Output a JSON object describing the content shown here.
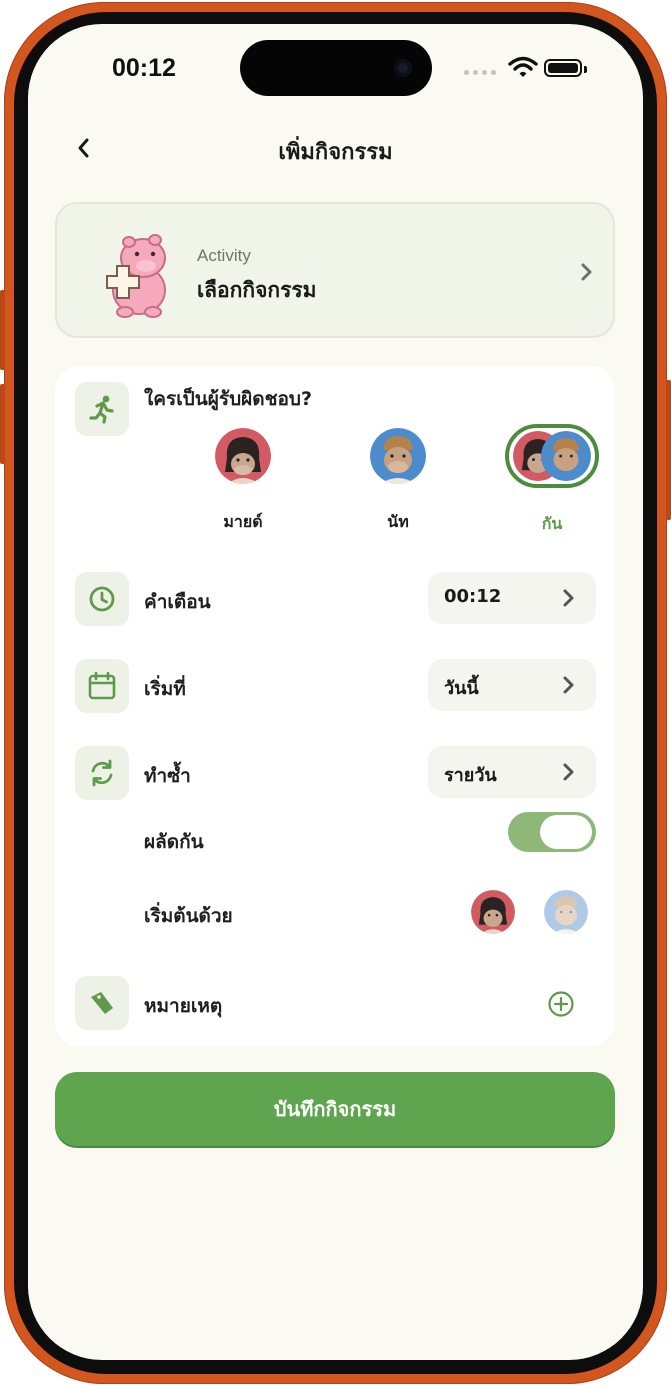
{
  "status_bar": {
    "time": "00:12"
  },
  "header": {
    "title": "เพิ่มกิจกรรม"
  },
  "activity": {
    "label": "Activity",
    "value": "เลือกกิจกรรม"
  },
  "responsible": {
    "question": "ใครเป็นผู้รับผิดชอบ?",
    "options": [
      {
        "name": "มายด์"
      },
      {
        "name": "นัท"
      },
      {
        "name": "กัน",
        "selected": true
      }
    ]
  },
  "reminder": {
    "label": "คำเตือน",
    "value": "00:12"
  },
  "start": {
    "label": "เริ่มที่",
    "value": "วันนี้"
  },
  "repeat": {
    "label": "ทำซ้ำ",
    "value": "รายวัน"
  },
  "alternate": {
    "label": "ผลัดกัน",
    "enabled": true
  },
  "start_with": {
    "label": "เริ่มต้นด้วย"
  },
  "note": {
    "label": "หมายเหตุ"
  },
  "save_button": {
    "label": "บันทึกกิจกรรม"
  },
  "colors": {
    "accent": "#5fa550",
    "frame": "#d4561f",
    "icon_bg": "#eef2e6"
  }
}
